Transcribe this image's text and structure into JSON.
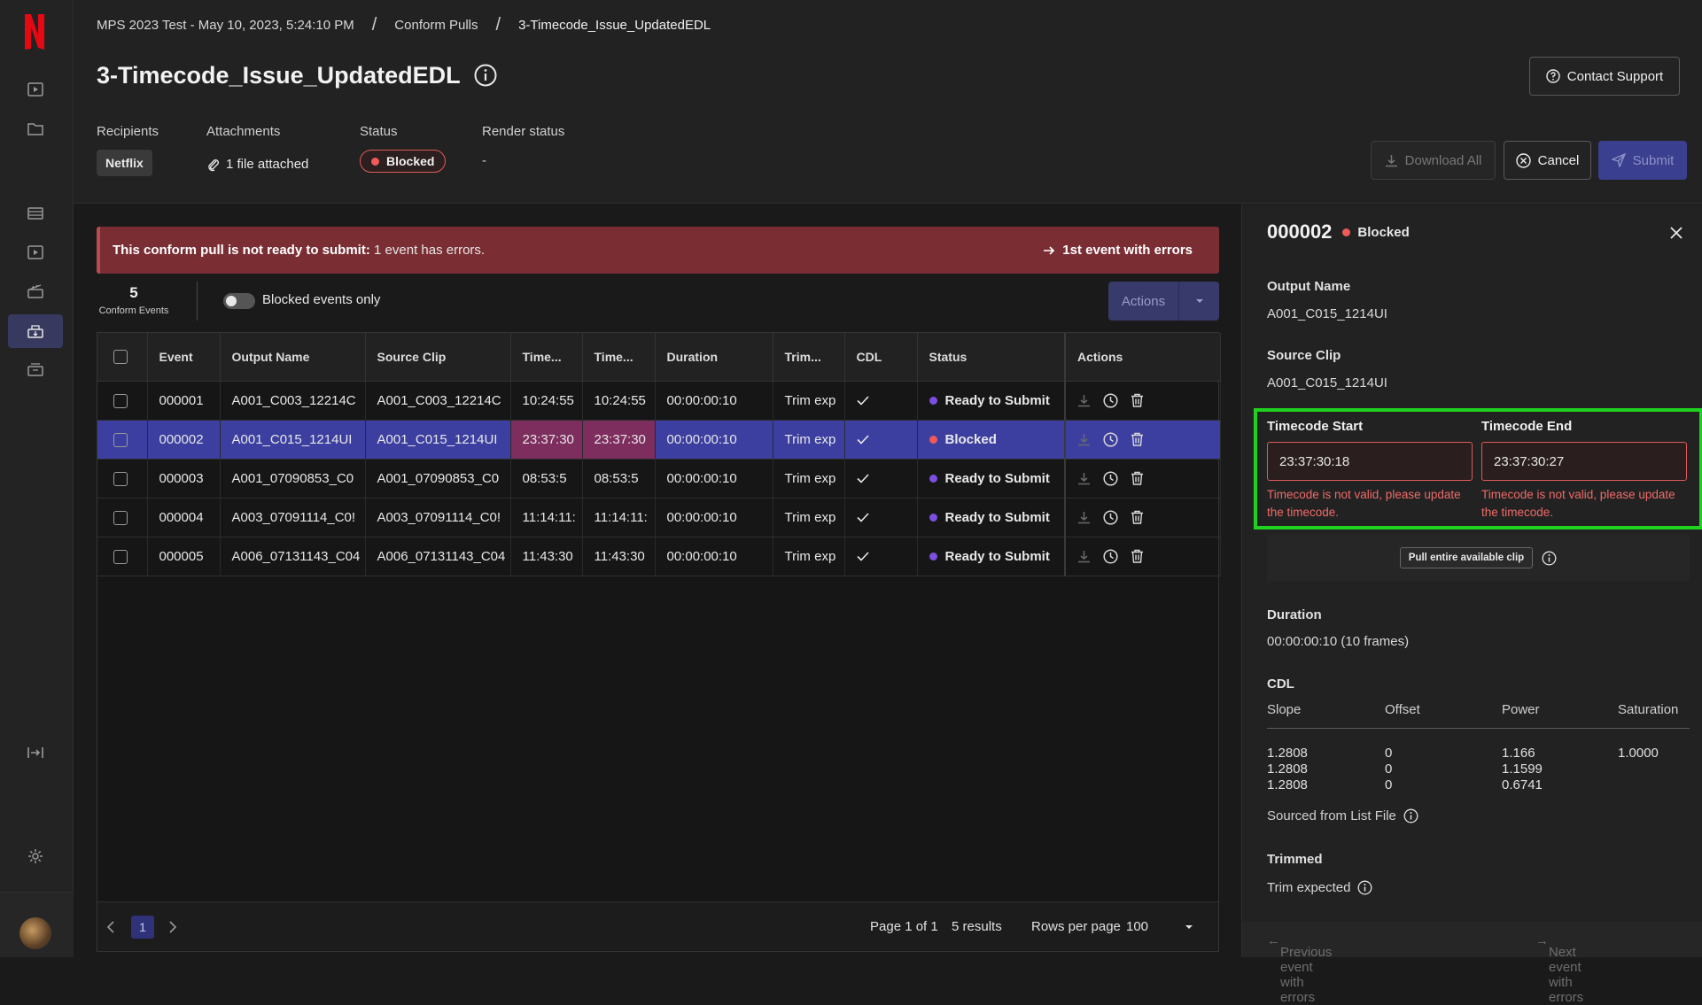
{
  "breadcrumbs": [
    "MPS 2023 Test - May 10, 2023, 5:24:10 PM",
    "Conform Pulls",
    "3-Timecode_Issue_UpdatedEDL"
  ],
  "page_title": "3-Timecode_Issue_UpdatedEDL",
  "header": {
    "recipients_label": "Recipients",
    "recipients_value": "Netflix",
    "attachments_label": "Attachments",
    "attachments_value": "1 file attached",
    "status_label": "Status",
    "status_value": "Blocked",
    "render_label": "Render status",
    "render_value": "-",
    "contact_support": "Contact Support",
    "download_all": "Download All",
    "cancel": "Cancel",
    "submit": "Submit"
  },
  "alert": {
    "bold": "This conform pull is not ready to submit:",
    "text": " 1 event has errors.",
    "link": "1st event with errors"
  },
  "events": {
    "count": "5",
    "count_label": "Conform Events",
    "toggle_label": "Blocked events only",
    "actions_label": "Actions"
  },
  "table": {
    "columns": [
      "Event",
      "Output Name",
      "Source Clip",
      "Time...",
      "Time...",
      "Duration",
      "Trim...",
      "CDL",
      "Status",
      "Actions"
    ],
    "rows": [
      {
        "event": "000001",
        "output": "A001_C003_12214C",
        "source": "A001_C003_12214C",
        "tc_start": "10:24:55",
        "tc_end": "10:24:55",
        "duration": "00:00:00:10",
        "trim": "Trim exp",
        "status": "Ready to Submit",
        "status_color": "#7b4fe0"
      },
      {
        "event": "000002",
        "output": "A001_C015_1214UI",
        "source": "A001_C015_1214UI",
        "tc_start": "23:37:30",
        "tc_end": "23:37:30",
        "duration": "00:00:00:10",
        "trim": "Trim exp",
        "status": "Blocked",
        "status_color": "#f05a5a"
      },
      {
        "event": "000003",
        "output": "A001_07090853_C0",
        "source": "A001_07090853_C0",
        "tc_start": "08:53:5",
        "tc_end": "08:53:5",
        "duration": "00:00:00:10",
        "trim": "Trim exp",
        "status": "Ready to Submit",
        "status_color": "#7b4fe0"
      },
      {
        "event": "000004",
        "output": "A003_07091114_C0!",
        "source": "A003_07091114_C0!",
        "tc_start": "11:14:11:",
        "tc_end": "11:14:11:",
        "duration": "00:00:00:10",
        "trim": "Trim exp",
        "status": "Ready to Submit",
        "status_color": "#7b4fe0"
      },
      {
        "event": "000005",
        "output": "A006_07131143_C04",
        "source": "A006_07131143_C04",
        "tc_start": "11:43:30",
        "tc_end": "11:43:30",
        "duration": "00:00:00:10",
        "trim": "Trim exp",
        "status": "Ready to Submit",
        "status_color": "#7b4fe0"
      }
    ]
  },
  "pager": {
    "page": "1",
    "page_of": "Page 1 of 1",
    "results": "5 results",
    "rows_label": "Rows per page",
    "rows_value": "100"
  },
  "panel": {
    "id": "000002",
    "status": "Blocked",
    "output_name_label": "Output Name",
    "output_name": "A001_C015_1214UI",
    "source_clip_label": "Source Clip",
    "source_clip": "A001_C015_1214UI",
    "tc_start_label": "Timecode Start",
    "tc_start": "23:37:30:18",
    "tc_end_label": "Timecode End",
    "tc_end": "23:37:30:27",
    "tc_error_1": "Timecode is not valid, please update",
    "tc_error_2": "the timecode.",
    "pull_btn": "Pull entire available clip",
    "duration_label": "Duration",
    "duration": "00:00:00:10 (10 frames)",
    "cdl_label": "CDL",
    "cdl_headers": [
      "Slope",
      "Offset",
      "Power",
      "Saturation"
    ],
    "cdl_rows": [
      [
        "1.2808",
        "0",
        "1.166",
        "1.0000"
      ],
      [
        "1.2808",
        "0",
        "1.1599",
        ""
      ],
      [
        "1.2808",
        "0",
        "0.6741",
        ""
      ]
    ],
    "sourced_from": "Sourced from List File",
    "trimmed_label": "Trimmed",
    "trimmed_value": "Trim expected",
    "prev_errors": "Previous event with errors",
    "next_errors": "Next event with errors"
  },
  "colors": {
    "accent": "#3b3f8f",
    "blocked": "#f05a5a",
    "ready": "#7b4fe0",
    "alert_bg": "#7a2e34",
    "highlight": "#1fd21f"
  }
}
